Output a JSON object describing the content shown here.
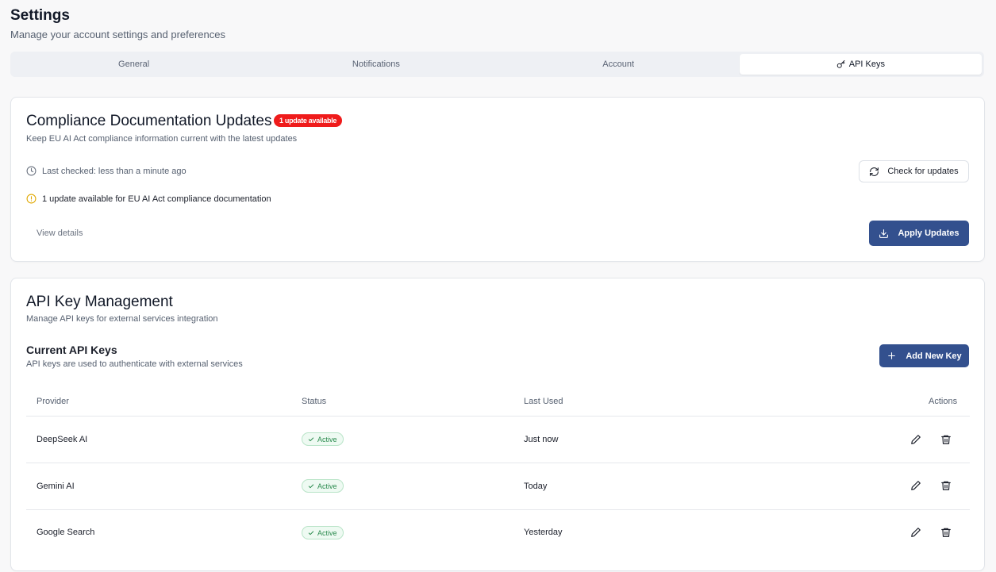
{
  "header": {
    "title": "Settings",
    "subtitle": "Manage your account settings and preferences"
  },
  "tabs": [
    {
      "label": "General",
      "active": false
    },
    {
      "label": "Notifications",
      "active": false
    },
    {
      "label": "Account",
      "active": false
    },
    {
      "label": "API Keys",
      "active": true,
      "icon": "key-icon"
    }
  ],
  "compliance": {
    "title": "Compliance Documentation Updates",
    "badge": "1 update available",
    "description": "Keep EU AI Act compliance information current with the latest updates",
    "last_checked": "Last checked: less than a minute ago",
    "check_button": "Check for updates",
    "warning": "1 update available for EU AI Act compliance documentation",
    "view_details": "View details",
    "apply_button": "Apply Updates"
  },
  "api_keys": {
    "title": "API Key Management",
    "description": "Manage API keys for external services integration",
    "section_title": "Current API Keys",
    "section_desc": "API keys are used to authenticate with external services",
    "add_button": "Add New Key",
    "columns": {
      "provider": "Provider",
      "status": "Status",
      "last_used": "Last Used",
      "actions": "Actions"
    },
    "rows": [
      {
        "provider": "DeepSeek AI",
        "status": "Active",
        "last_used": "Just now"
      },
      {
        "provider": "Gemini AI",
        "status": "Active",
        "last_used": "Today"
      },
      {
        "provider": "Google Search",
        "status": "Active",
        "last_used": "Yesterday"
      }
    ]
  },
  "colors": {
    "primary": "#33508e",
    "danger": "#ef1b1b",
    "success": "#2b8b4e",
    "warning": "#e0a800"
  }
}
